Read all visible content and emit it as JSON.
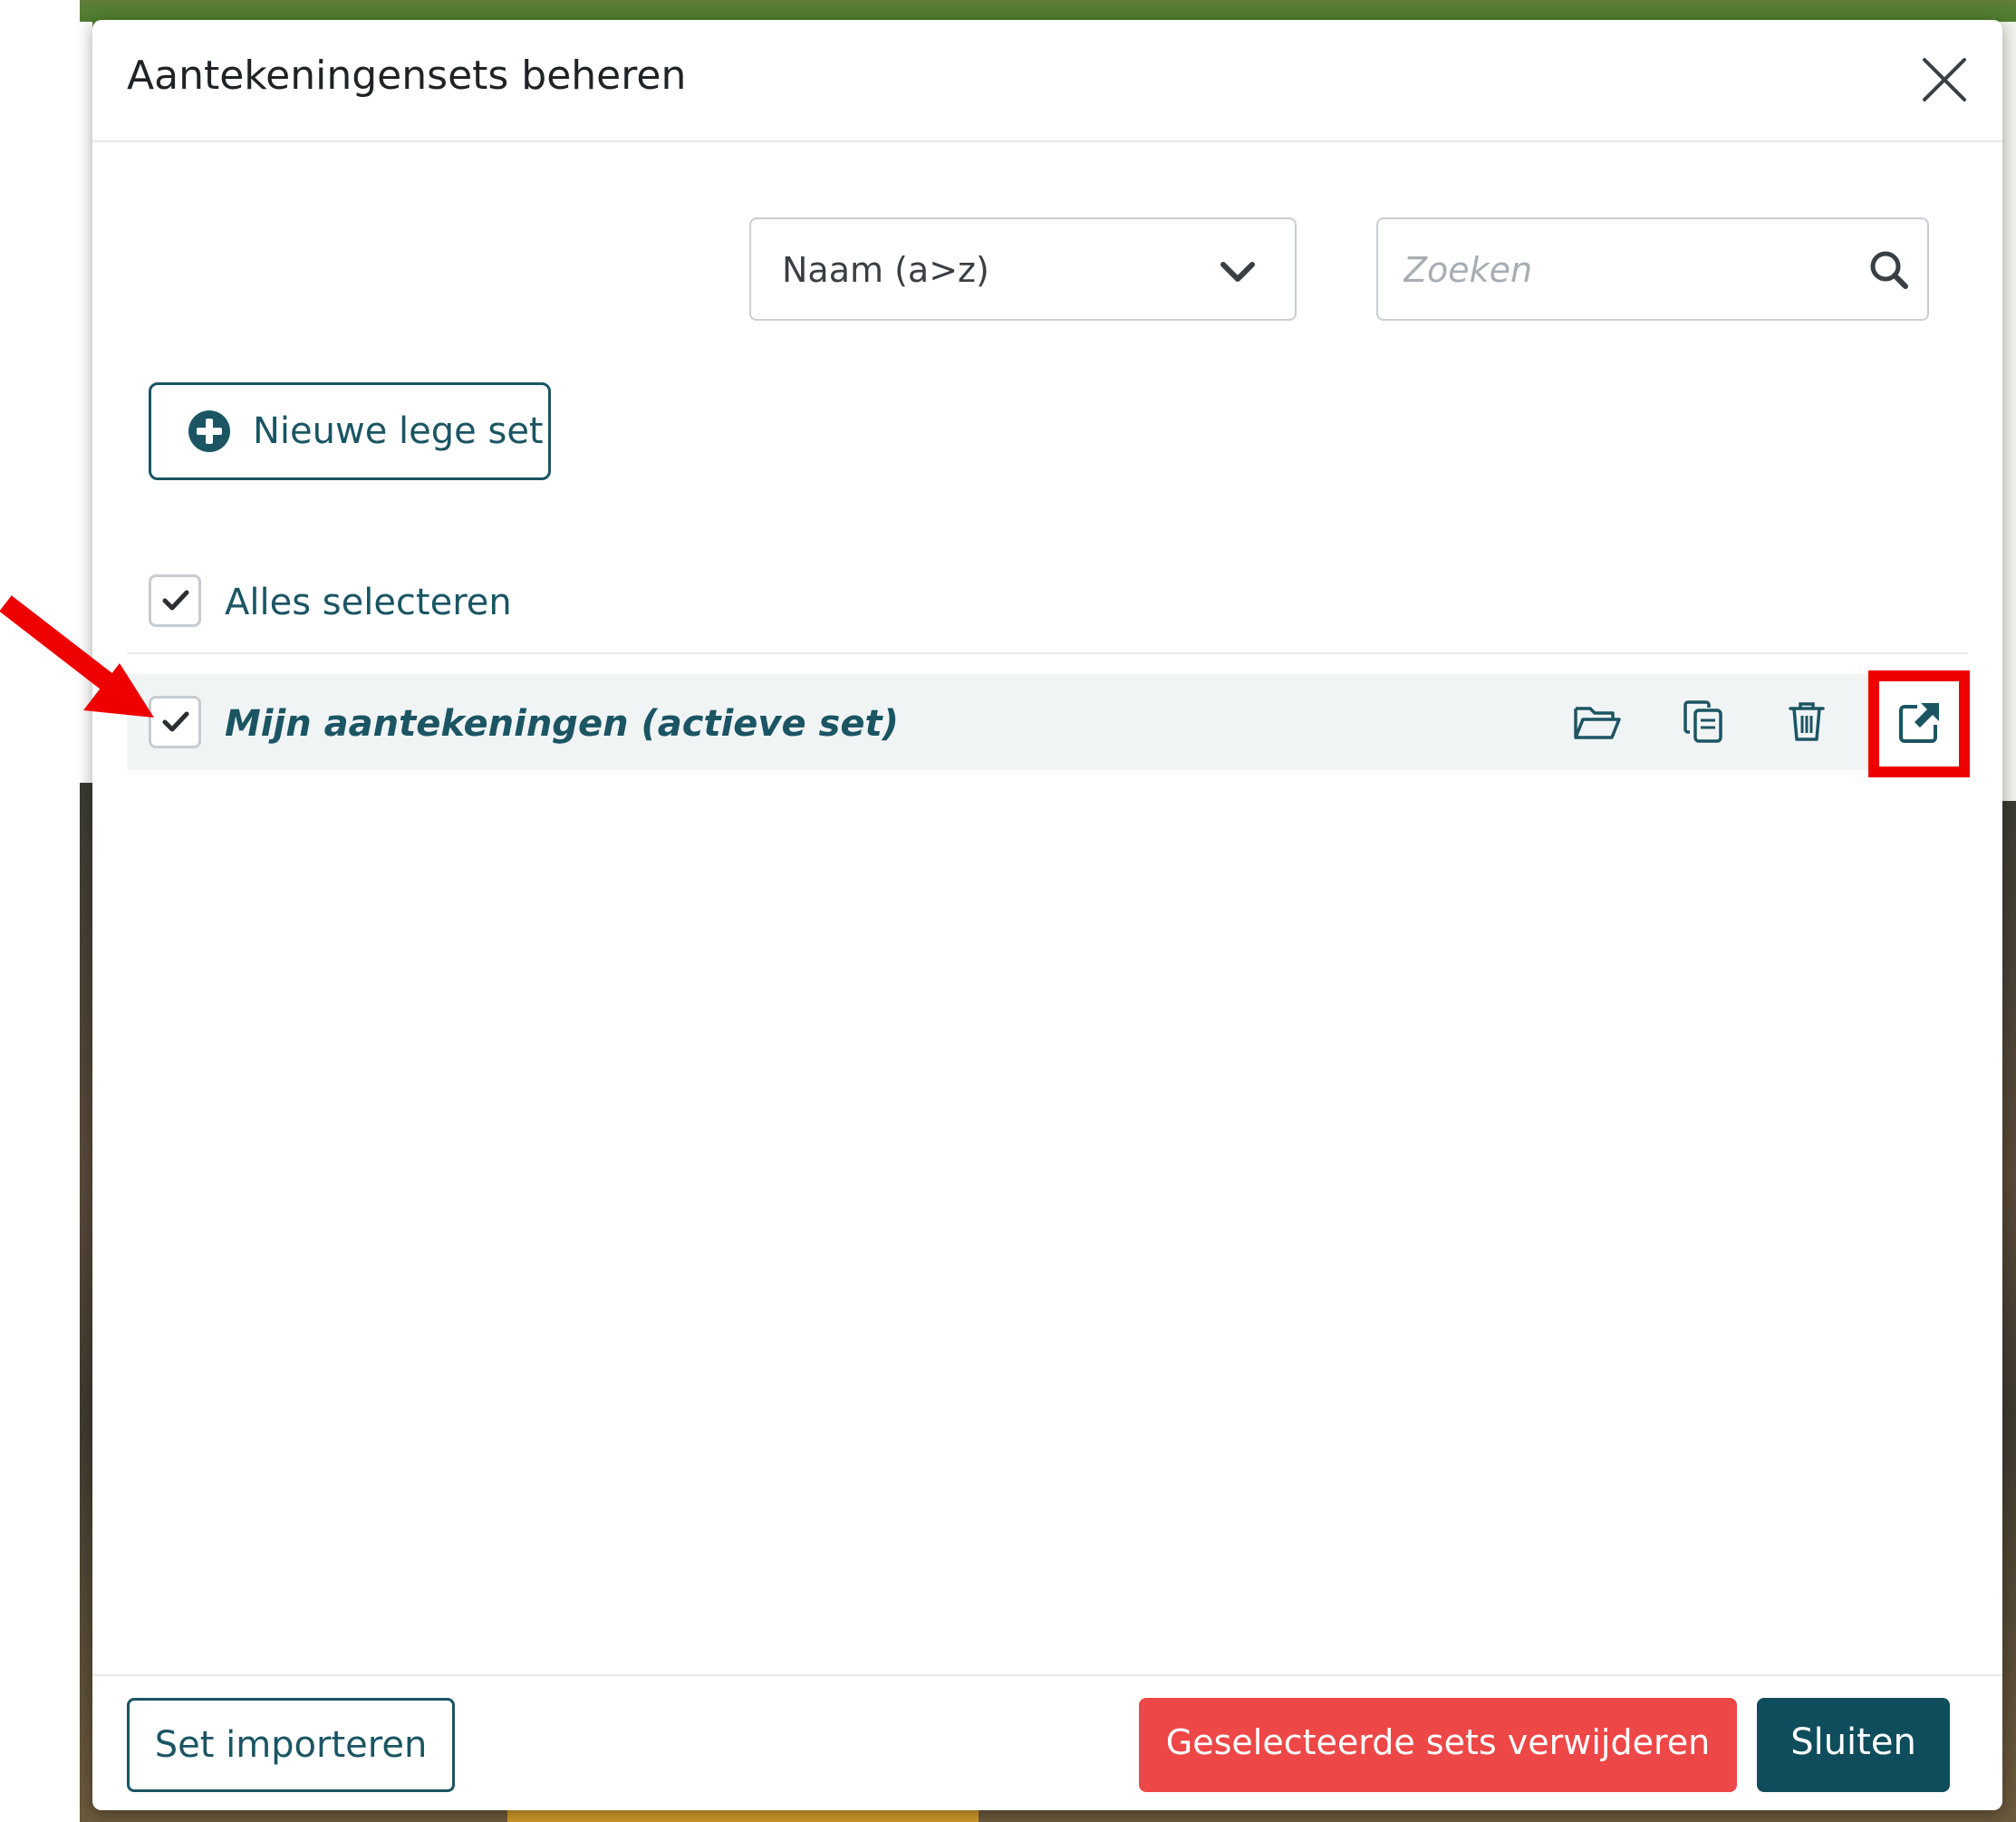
{
  "modal": {
    "title": "Aantekeningensets beheren"
  },
  "sort": {
    "selected": "Naam (a>z)"
  },
  "search": {
    "placeholder": "Zoeken"
  },
  "new_set_button": {
    "label": "Nieuwe lege set"
  },
  "select_all": {
    "label": "Alles selecteren",
    "checked": true
  },
  "sets": [
    {
      "name": "Mijn aantekeningen (actieve set)",
      "checked": true,
      "actions": [
        "folder-open-icon",
        "copy-icon",
        "trash-icon",
        "external-link-icon"
      ]
    }
  ],
  "footer": {
    "import_label": "Set importeren",
    "delete_label": "Geselecteerde sets verwijderen",
    "close_label": "Sluiten"
  },
  "colors": {
    "primary": "#1b5563",
    "danger": "#ee4747",
    "close_button": "#0f4d5c",
    "annotation": "#ee0000"
  }
}
